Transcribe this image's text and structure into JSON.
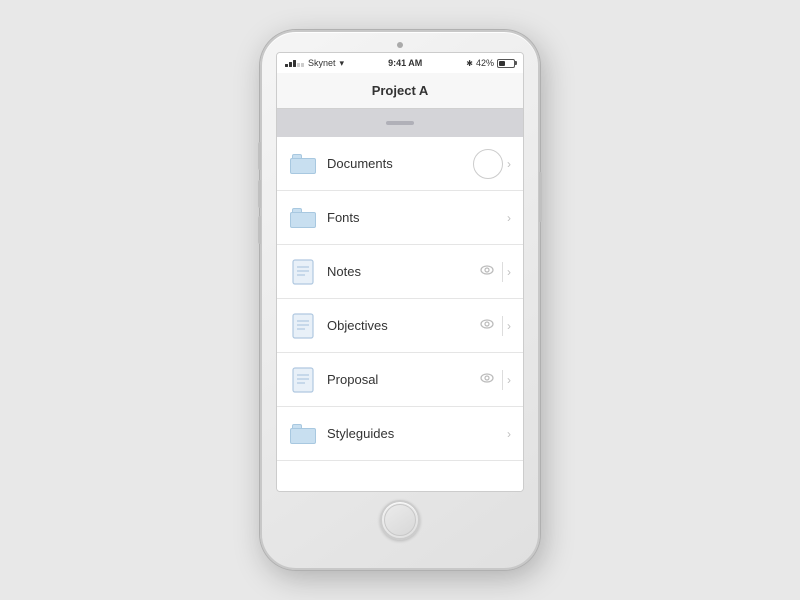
{
  "status_bar": {
    "carrier": "Skynet",
    "time": "9:41 AM",
    "battery_pct": "42%",
    "wifi": true,
    "bluetooth": true
  },
  "title": "Project A",
  "list_items": [
    {
      "id": "documents",
      "label": "Documents",
      "icon_type": "folder",
      "has_eye": false,
      "has_circle": true,
      "has_chevron": true
    },
    {
      "id": "fonts",
      "label": "Fonts",
      "icon_type": "folder",
      "has_eye": false,
      "has_circle": false,
      "has_chevron": true
    },
    {
      "id": "notes",
      "label": "Notes",
      "icon_type": "document",
      "has_eye": true,
      "has_circle": false,
      "has_chevron": true
    },
    {
      "id": "objectives",
      "label": "Objectives",
      "icon_type": "document",
      "has_eye": true,
      "has_circle": false,
      "has_chevron": true
    },
    {
      "id": "proposal",
      "label": "Proposal",
      "icon_type": "document",
      "has_eye": true,
      "has_circle": false,
      "has_chevron": true
    },
    {
      "id": "styleguides",
      "label": "Styleguides",
      "icon_type": "folder",
      "has_eye": false,
      "has_circle": false,
      "has_chevron": true
    }
  ],
  "icons": {
    "chevron": "›",
    "eye": "👁",
    "bluetooth": "B"
  }
}
